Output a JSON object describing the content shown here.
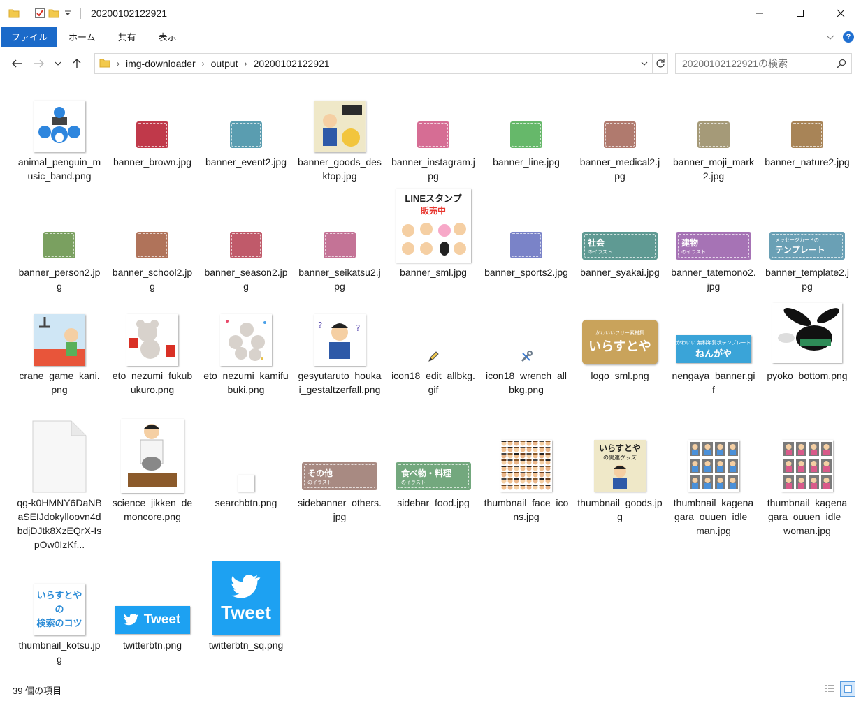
{
  "window": {
    "title": "20200102122921"
  },
  "ribbon": {
    "tabs": [
      "ファイル",
      "ホーム",
      "共有",
      "表示"
    ]
  },
  "address": {
    "crumbs": [
      "img-downloader",
      "output",
      "20200102122921"
    ]
  },
  "search": {
    "placeholder": "20200102122921の検索"
  },
  "files": [
    {
      "name": "animal_penguin_music_band.png"
    },
    {
      "name": "banner_brown.jpg"
    },
    {
      "name": "banner_event2.jpg"
    },
    {
      "name": "banner_goods_desktop.jpg"
    },
    {
      "name": "banner_instagram.jpg"
    },
    {
      "name": "banner_line.jpg"
    },
    {
      "name": "banner_medical2.jpg"
    },
    {
      "name": "banner_moji_mark2.jpg"
    },
    {
      "name": "banner_nature2.jpg"
    },
    {
      "name": "banner_person2.jpg"
    },
    {
      "name": "banner_school2.jpg"
    },
    {
      "name": "banner_season2.jpg"
    },
    {
      "name": "banner_seikatsu2.jpg"
    },
    {
      "name": "banner_sml.jpg"
    },
    {
      "name": "banner_sports2.jpg"
    },
    {
      "name": "banner_syakai.jpg"
    },
    {
      "name": "banner_tatemono2.jpg"
    },
    {
      "name": "banner_template2.jpg"
    },
    {
      "name": "crane_game_kani.png"
    },
    {
      "name": "eto_nezumi_fukubukuro.png"
    },
    {
      "name": "eto_nezumi_kamifubuki.png"
    },
    {
      "name": "gesyutaruto_houkai_gestaltzerfall.png"
    },
    {
      "name": "icon18_edit_allbkg.gif"
    },
    {
      "name": "icon18_wrench_allbkg.png"
    },
    {
      "name": "logo_sml.png"
    },
    {
      "name": "nengaya_banner.gif"
    },
    {
      "name": "pyoko_bottom.png"
    },
    {
      "name": "qg-k0HMNY6DaNBaSEIJdokylloovn4dbdjDJtk8XzEQrX-IspOw0IzKf..."
    },
    {
      "name": "science_jikken_demoncore.png"
    },
    {
      "name": "searchbtn.png"
    },
    {
      "name": "sidebanner_others.jpg"
    },
    {
      "name": "sidebar_food.jpg"
    },
    {
      "name": "thumbnail_face_icons.jpg"
    },
    {
      "name": "thumbnail_goods.jpg"
    },
    {
      "name": "thumbnail_kagenagara_ouuen_idle_man.jpg"
    },
    {
      "name": "thumbnail_kagenagara_ouuen_idle_woman.jpg"
    },
    {
      "name": "thumbnail_kotsu.jpg"
    },
    {
      "name": "twitterbtn.png"
    },
    {
      "name": "twitterbtn_sq.png"
    }
  ],
  "thumb_text": {
    "syakai": "社会",
    "tatemono": "建物",
    "template_top": "メッセージカードの",
    "template": "テンプレート",
    "irasuto": "のイラスト",
    "others": "その他",
    "food": "食べ物・料理",
    "line_stamp": "LINEスタンプ",
    "hanbai": "販売中",
    "logo": "いらすとや",
    "logo_sub": "かわいいフリー素材集",
    "nengaya": "ねんがや",
    "nengaya_sub": "かわいい 無料年賀状テンプレート",
    "goods_title": "いらすとや",
    "goods_sub": "の関連グッズ",
    "kotsu_1": "いらすとや",
    "kotsu_2": "の",
    "kotsu_3": "検索のコツ",
    "tweet": "Tweet"
  },
  "status": {
    "count": "39 個の項目"
  },
  "colors": {
    "accent": "#1b6ac9",
    "twitter": "#1da1f2"
  }
}
